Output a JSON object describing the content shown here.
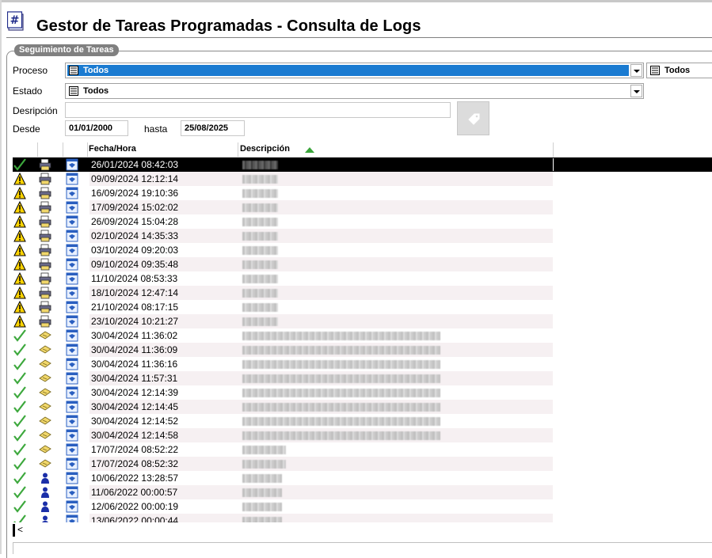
{
  "window": {
    "title": "Gestor de Tareas Programadas - Consulta de Logs"
  },
  "filters": {
    "group_title": "Seguimiento de Tareas",
    "proceso_label": "Proceso",
    "proceso_value": "Todos",
    "proceso_secondary_value": "Todos",
    "estado_label": "Estado",
    "estado_value": "Todos",
    "descripcion_label": "Desripción",
    "descripcion_value": "",
    "desde_label": "Desde",
    "desde_value": "01/01/2000",
    "hasta_label": "hasta",
    "hasta_value": "25/08/2025"
  },
  "grid": {
    "columns": [
      "",
      "",
      "",
      "Fecha/Hora",
      "Descripción"
    ],
    "sort": {
      "column": "Descripción",
      "direction": "ascending"
    },
    "rows": [
      {
        "status": "ok-icon",
        "type": "printer-icon",
        "app": "app-window-icon",
        "datetime": "26/01/2024 08:42:03",
        "desc_len": 45,
        "selected": true
      },
      {
        "status": "warning-icon",
        "type": "printer-icon",
        "app": "app-window-icon",
        "datetime": "09/09/2024 12:12:14",
        "desc_len": 45
      },
      {
        "status": "warning-icon",
        "type": "printer-icon",
        "app": "app-window-icon",
        "datetime": "16/09/2024 19:10:36",
        "desc_len": 45
      },
      {
        "status": "warning-icon",
        "type": "printer-icon",
        "app": "app-window-icon",
        "datetime": "17/09/2024 15:02:02",
        "desc_len": 45
      },
      {
        "status": "warning-icon",
        "type": "printer-icon",
        "app": "app-window-icon",
        "datetime": "26/09/2024 15:04:28",
        "desc_len": 45
      },
      {
        "status": "warning-icon",
        "type": "printer-icon",
        "app": "app-window-icon",
        "datetime": "02/10/2024 14:35:33",
        "desc_len": 45
      },
      {
        "status": "warning-icon",
        "type": "printer-icon",
        "app": "app-window-icon",
        "datetime": "03/10/2024 09:20:03",
        "desc_len": 45
      },
      {
        "status": "warning-icon",
        "type": "printer-icon",
        "app": "app-window-icon",
        "datetime": "09/10/2024 09:35:48",
        "desc_len": 45
      },
      {
        "status": "warning-icon",
        "type": "printer-icon",
        "app": "app-window-icon",
        "datetime": "11/10/2024 08:53:33",
        "desc_len": 45
      },
      {
        "status": "warning-icon",
        "type": "printer-icon",
        "app": "app-window-icon",
        "datetime": "18/10/2024 12:47:14",
        "desc_len": 45
      },
      {
        "status": "warning-icon",
        "type": "printer-icon",
        "app": "app-window-icon",
        "datetime": "21/10/2024 08:17:15",
        "desc_len": 45
      },
      {
        "status": "warning-icon",
        "type": "printer-icon",
        "app": "app-window-icon",
        "datetime": "23/10/2024 10:21:27",
        "desc_len": 45
      },
      {
        "status": "ok-icon",
        "type": "ticket-icon",
        "app": "app-window-icon",
        "datetime": "30/04/2024 11:36:02",
        "desc_len": 250
      },
      {
        "status": "ok-icon",
        "type": "ticket-icon",
        "app": "app-window-icon",
        "datetime": "30/04/2024 11:36:09",
        "desc_len": 250
      },
      {
        "status": "ok-icon",
        "type": "ticket-icon",
        "app": "app-window-icon",
        "datetime": "30/04/2024 11:36:16",
        "desc_len": 250
      },
      {
        "status": "ok-icon",
        "type": "ticket-icon",
        "app": "app-window-icon",
        "datetime": "30/04/2024 11:57:31",
        "desc_len": 250
      },
      {
        "status": "ok-icon",
        "type": "ticket-icon",
        "app": "app-window-icon",
        "datetime": "30/04/2024 12:14:39",
        "desc_len": 250
      },
      {
        "status": "ok-icon",
        "type": "ticket-icon",
        "app": "app-window-icon",
        "datetime": "30/04/2024 12:14:45",
        "desc_len": 250
      },
      {
        "status": "ok-icon",
        "type": "ticket-icon",
        "app": "app-window-icon",
        "datetime": "30/04/2024 12:14:52",
        "desc_len": 250
      },
      {
        "status": "ok-icon",
        "type": "ticket-icon",
        "app": "app-window-icon",
        "datetime": "30/04/2024 12:14:58",
        "desc_len": 250
      },
      {
        "status": "ok-icon",
        "type": "ticket-icon",
        "app": "app-window-icon",
        "datetime": "17/07/2024 08:52:22",
        "desc_len": 55
      },
      {
        "status": "ok-icon",
        "type": "ticket-icon",
        "app": "app-window-icon",
        "datetime": "17/07/2024 08:52:32",
        "desc_len": 55
      },
      {
        "status": "ok-icon",
        "type": "user-icon",
        "app": "app-window-icon",
        "datetime": "10/06/2022 13:28:57",
        "desc_len": 50
      },
      {
        "status": "ok-icon",
        "type": "user-icon",
        "app": "app-window-icon",
        "datetime": "11/06/2022 00:00:57",
        "desc_len": 50
      },
      {
        "status": "ok-icon",
        "type": "user-icon",
        "app": "app-window-icon",
        "datetime": "12/06/2022 00:00:19",
        "desc_len": 50
      },
      {
        "status": "ok-icon",
        "type": "user-icon",
        "app": "app-window-icon",
        "datetime": "13/06/2022 00:00:44",
        "desc_len": 50
      }
    ]
  },
  "colors": {
    "selection": "#1a7bd1",
    "row_selected": "#000000",
    "row_alt": "#f6f0f2",
    "sort_arrow": "#3aa43a"
  }
}
